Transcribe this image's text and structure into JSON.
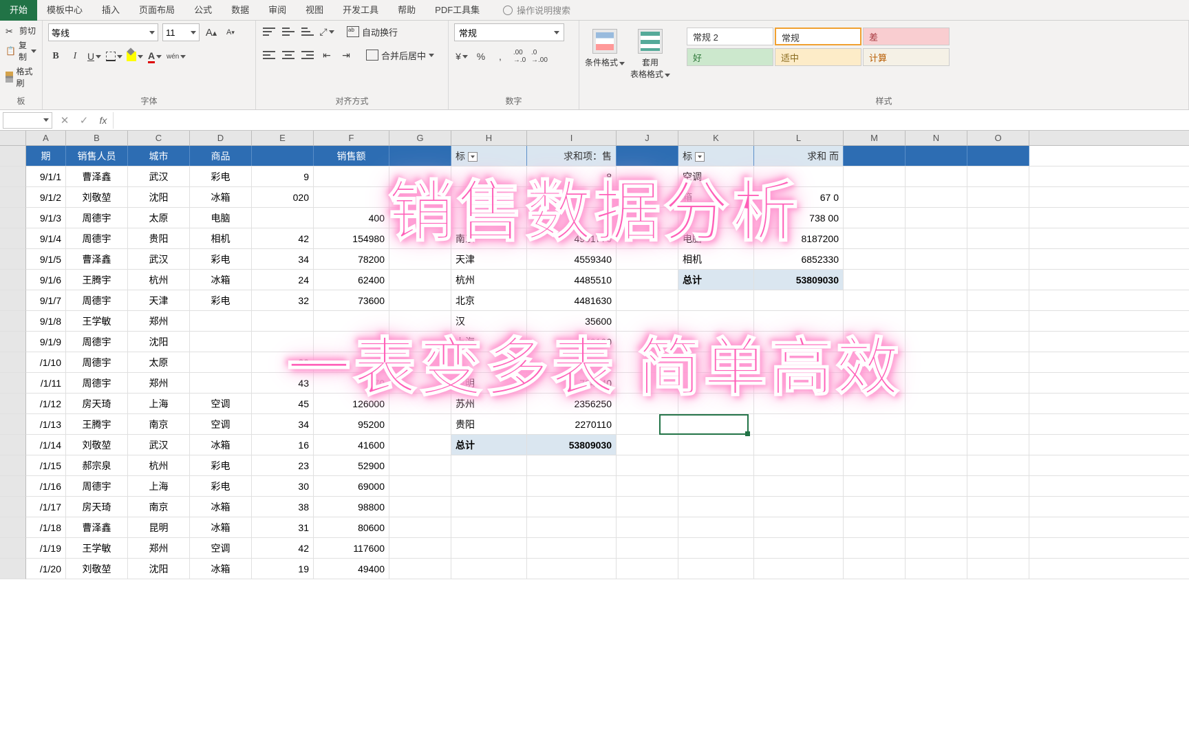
{
  "menu": {
    "tabs": [
      "开始",
      "模板中心",
      "插入",
      "页面布局",
      "公式",
      "数据",
      "审阅",
      "视图",
      "开发工具",
      "帮助",
      "PDF工具集"
    ],
    "search_hint": "操作说明搜索"
  },
  "ribbon": {
    "clipboard": {
      "cut": "剪切",
      "copy": "复制",
      "brush": "格式刷",
      "label": "板"
    },
    "font": {
      "name": "等线",
      "size": "11",
      "bold": "B",
      "italic": "I",
      "underline": "U",
      "wen": "wén",
      "label": "字体"
    },
    "align": {
      "wrap": "自动换行",
      "merge": "合并后居中",
      "label": "对齐方式"
    },
    "number": {
      "format": "常规",
      "label": "数字"
    },
    "styles": {
      "cond": "条件格式",
      "table": "套用\n表格格式",
      "cells": [
        [
          {
            "t": "常规 2",
            "bg": "#ffffff",
            "fg": "#333"
          },
          {
            "t": "常规",
            "bg": "#ffffff",
            "fg": "#333",
            "sel": true
          },
          {
            "t": "差",
            "bg": "#f9cdd0",
            "fg": "#a6383e"
          }
        ],
        [
          {
            "t": "好",
            "bg": "#cce8cd",
            "fg": "#2d7738"
          },
          {
            "t": "适中",
            "bg": "#fdecc8",
            "fg": "#8a6b1f"
          },
          {
            "t": "计算",
            "bg": "#f5f1e6",
            "fg": "#b85c00"
          }
        ]
      ],
      "label": "样式"
    }
  },
  "columns": [
    "A",
    "B",
    "C",
    "D",
    "E",
    "F",
    "G",
    "H",
    "I",
    "J",
    "K",
    "L",
    "M",
    "N",
    "O"
  ],
  "table_headers": {
    "a": "期",
    "b": "销售人员",
    "c": "城市",
    "d": "商品",
    "e": "",
    "f": "销售额"
  },
  "table_rows": [
    {
      "a": "9/1/1",
      "b": "曹泽鑫",
      "c": "武汉",
      "d": "彩电",
      "e": "9",
      "f": ""
    },
    {
      "a": "9/1/2",
      "b": "刘敬堃",
      "c": "沈阳",
      "d": "冰箱",
      "e": "020",
      "f": ""
    },
    {
      "a": "9/1/3",
      "b": "周德宇",
      "c": "太原",
      "d": "电脑",
      "e": "",
      "f": "400"
    },
    {
      "a": "9/1/4",
      "b": "周德宇",
      "c": "贵阳",
      "d": "相机",
      "e": "42",
      "f": "154980"
    },
    {
      "a": "9/1/5",
      "b": "曹泽鑫",
      "c": "武汉",
      "d": "彩电",
      "e": "34",
      "f": "78200"
    },
    {
      "a": "9/1/6",
      "b": "王腾宇",
      "c": "杭州",
      "d": "冰箱",
      "e": "24",
      "f": "62400"
    },
    {
      "a": "9/1/7",
      "b": "周德宇",
      "c": "天津",
      "d": "彩电",
      "e": "32",
      "f": "73600"
    },
    {
      "a": "9/1/8",
      "b": "王学敏",
      "c": "郑州",
      "d": "",
      "e": "",
      "f": ""
    },
    {
      "a": "9/1/9",
      "b": "周德宇",
      "c": "沈阳",
      "d": "",
      "e": "",
      "f": ""
    },
    {
      "a": "/1/10",
      "b": "周德宇",
      "c": "太原",
      "d": "",
      "e": "20",
      "f": ""
    },
    {
      "a": "/1/11",
      "b": "周德宇",
      "c": "郑州",
      "d": "",
      "e": "43",
      "f": "670"
    },
    {
      "a": "/1/12",
      "b": "房天琦",
      "c": "上海",
      "d": "空调",
      "e": "45",
      "f": "126000"
    },
    {
      "a": "/1/13",
      "b": "王腾宇",
      "c": "南京",
      "d": "空调",
      "e": "34",
      "f": "95200"
    },
    {
      "a": "/1/14",
      "b": "刘敬堃",
      "c": "武汉",
      "d": "冰箱",
      "e": "16",
      "f": "41600"
    },
    {
      "a": "/1/15",
      "b": "郝宗泉",
      "c": "杭州",
      "d": "彩电",
      "e": "23",
      "f": "52900"
    },
    {
      "a": "/1/16",
      "b": "周德宇",
      "c": "上海",
      "d": "彩电",
      "e": "30",
      "f": "69000"
    },
    {
      "a": "/1/17",
      "b": "房天琦",
      "c": "南京",
      "d": "冰箱",
      "e": "38",
      "f": "98800"
    },
    {
      "a": "/1/18",
      "b": "曹泽鑫",
      "c": "昆明",
      "d": "冰箱",
      "e": "31",
      "f": "80600"
    },
    {
      "a": "/1/19",
      "b": "王学敏",
      "c": "郑州",
      "d": "空调",
      "e": "42",
      "f": "117600"
    },
    {
      "a": "/1/20",
      "b": "刘敬堃",
      "c": "沈阳",
      "d": "冰箱",
      "e": "19",
      "f": "49400"
    }
  ],
  "pivot_city": {
    "header_h": "标",
    "header_i": "求和项：售",
    "rows": [
      {
        "h": "",
        "i": "8"
      },
      {
        "h": "",
        "i": ""
      },
      {
        "h": "",
        "i": ""
      },
      {
        "h": "南京",
        "i": "4901770"
      },
      {
        "h": "天津",
        "i": "4559340"
      },
      {
        "h": "杭州",
        "i": "4485510"
      },
      {
        "h": "北京",
        "i": "4481630"
      },
      {
        "h": "汉",
        "i": "35600"
      },
      {
        "h": "上海",
        "i": "049100"
      },
      {
        "h": "",
        "i": "940410"
      },
      {
        "h": "昆明",
        "i": "784540"
      },
      {
        "h": "苏州",
        "i": "2356250"
      },
      {
        "h": "贵阳",
        "i": "2270110"
      }
    ],
    "total_h": "总计",
    "total_i": "53809030"
  },
  "pivot_prod": {
    "header_k": "标",
    "header_l": "求和 而",
    "rows": [
      {
        "k": "空调",
        "l": ""
      },
      {
        "k": "箱",
        "l": "67 0"
      },
      {
        "k": "",
        "l": "738 00"
      },
      {
        "k": "电脑",
        "l": "8187200"
      },
      {
        "k": "相机",
        "l": "6852330"
      }
    ],
    "total_k": "总计",
    "total_l": "53809030"
  },
  "overlay": {
    "line1": "销售数据分析",
    "line2": "一表变多表 简单高效"
  }
}
